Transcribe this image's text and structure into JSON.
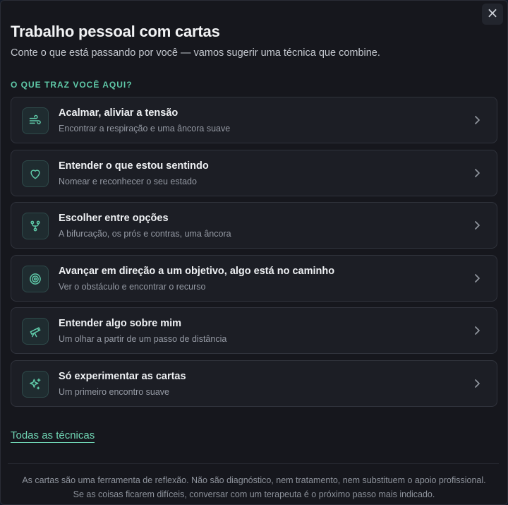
{
  "modal": {
    "close_label": "×",
    "title": "Trabalho pessoal com cartas",
    "subtitle": "Conte o que está passando por você — vamos sugerir uma técnica que combine.",
    "section_label": "O QUE TRAZ VOCÊ AQUI?",
    "options": [
      {
        "icon": "wind-icon",
        "title": "Acalmar, aliviar a tensão",
        "subtitle": "Encontrar a respiração e uma âncora suave"
      },
      {
        "icon": "heart-icon",
        "title": "Entender o que estou sentindo",
        "subtitle": "Nomear e reconhecer o seu estado"
      },
      {
        "icon": "git-fork-icon",
        "title": "Escolher entre opções",
        "subtitle": "A bifurcação, os prós e contras, uma âncora"
      },
      {
        "icon": "target-icon",
        "title": "Avançar em direção a um objetivo, algo está no caminho",
        "subtitle": "Ver o obstáculo e encontrar o recurso"
      },
      {
        "icon": "telescope-icon",
        "title": "Entender algo sobre mim",
        "subtitle": "Um olhar a partir de um passo de distância"
      },
      {
        "icon": "sparkles-icon",
        "title": "Só experimentar as cartas",
        "subtitle": "Um primeiro encontro suave"
      }
    ],
    "all_techniques_link": "Todas as técnicas",
    "footer_line1": "As cartas são uma ferramenta de reflexão. Não são diagnóstico, nem tratamento, nem substituem o apoio profissional.",
    "footer_line2": "Se as coisas ficarem difíceis, conversar com um terapeuta é o próximo passo mais indicado."
  },
  "colors": {
    "accent": "#5fc9a8",
    "background": "#16171d",
    "card": "#1c1e25"
  }
}
